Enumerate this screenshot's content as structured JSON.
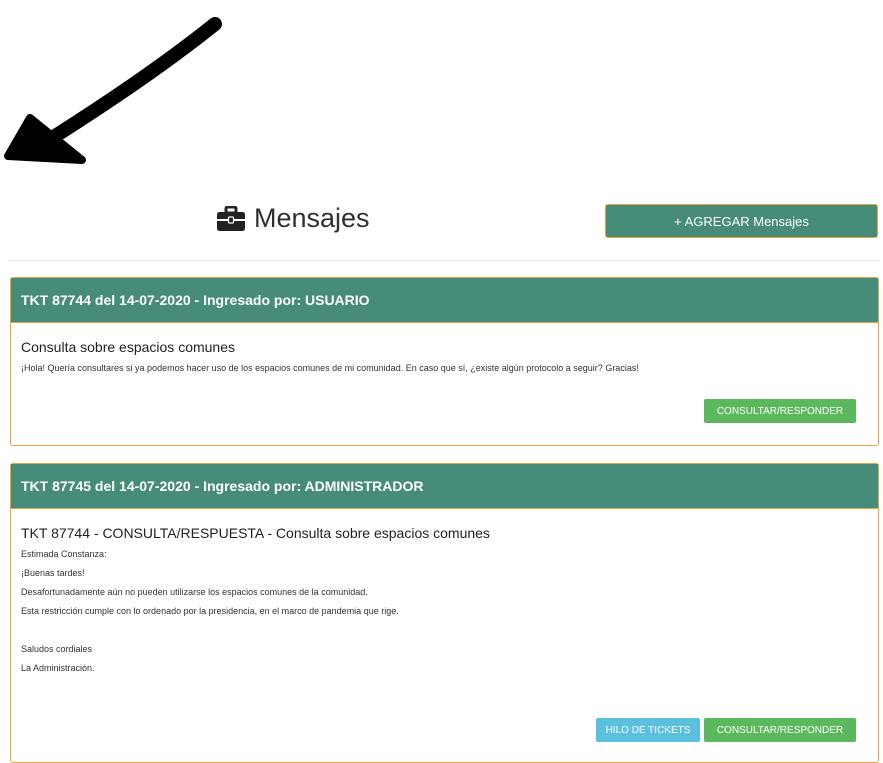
{
  "header": {
    "title": "Mensajes",
    "title_icon": "briefcase-icon",
    "add_button_label": "+ AGREGAR Mensajes"
  },
  "colors": {
    "panel_header": "#468c78",
    "panel_border": "#e6a23c",
    "green_button": "#5cb85c",
    "blue_button": "#5bc0de"
  },
  "tickets": [
    {
      "header": "TKT 87744 del 14-07-2020 - Ingresado por: USUARIO",
      "subject": "Consulta sobre espacios comunes",
      "body": [
        "¡Hola! Quería consultares si ya podemos hacer uso de los espacios comunes de mi comunidad. En caso que sí, ¿existe algún protocolo a seguir? Gracias!"
      ],
      "consult_button": "CONSULTAR/RESPONDER"
    },
    {
      "header": "TKT 87745 del 14-07-2020 - Ingresado por: ADMINISTRADOR",
      "subject": "TKT 87744 - CONSULTA/RESPUESTA - Consulta sobre espacios comunes",
      "body": [
        "Estimada Constanza:",
        "¡Buenas tardes!",
        "Desafortunadamente aún no pueden utilizarse los espacios comunes de la comunidad.",
        "Esta restricción cumple con lo ordenado por la presidencia, en el marco de pandemia que rige.",
        "",
        "Saludos cordiales",
        "La Administración."
      ],
      "thread_button": "HILO DE TICKETS",
      "consult_button": "CONSULTAR/RESPONDER"
    }
  ]
}
